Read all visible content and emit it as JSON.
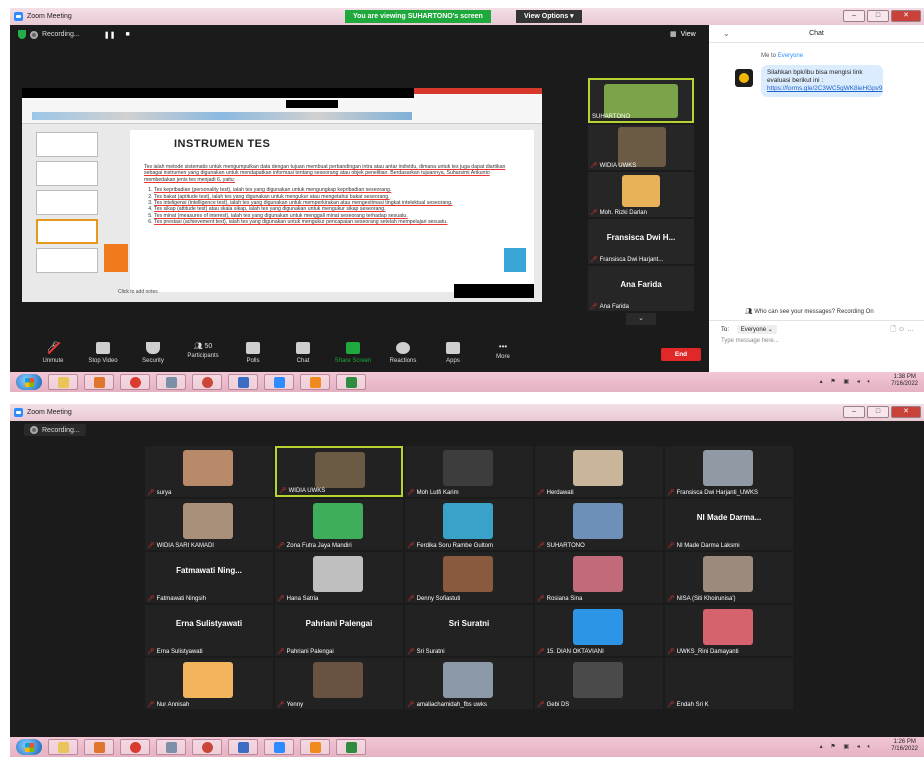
{
  "window1": {
    "title": "Zoom Meeting",
    "viewing_banner": "You are viewing SUHARTONO's screen",
    "view_options": "View Options",
    "recording": "Recording...",
    "view_label": "View",
    "slide": {
      "heading": "INSTRUMEN TES",
      "intro": "Tes ialah metode sistematis untuk mengumpulkan data dengan tujuan membuat perbandingan intra atau antar individu, dimana untuk tes juga dapat diartikan sebagai instrumen yang digunakan untuk mendapatkan informasi tentang seseorang atau objek penelitian. Berdasarkan tujuannya, Suharsimi Arikunto membedakan jenis tes menjadi 6, yaitu:",
      "items": [
        "Tes kepribadian (personality test), ialah tes yang digunakan untuk mengungkap kepribadian seseorang.",
        "Tes bakat (aptitude test), ialah tes yang digunakan untuk mengukur atau mengetahui bakat seseorang.",
        "Tes inteligensi (intelligence test), ialah tes yang digunakan untuk memperkirakan atau mengestimasi tingkat intelektual seseorang.",
        "Tes sikap (attitude test) atau skala sikap, ialah tes yang digunakan untuk mengukur sikap seseorang.",
        "Tes minat (measures of interest), ialah tes yang digunakan untuk menggali minat seseorang terhadap sesuatu.",
        "Tes prestasi (achievement test), ialah tes yang digunakan untuk mengukur pencapaian seseorang setelah mempelajari sesuatu."
      ],
      "notes": "Click to add notes"
    },
    "side_participants": [
      {
        "name": "SUHARTONO",
        "type": "video",
        "color": "#7aa34a",
        "active": true
      },
      {
        "name": "WIDIA UWKS",
        "type": "video",
        "color": "#6b5a44",
        "active": false
      },
      {
        "name": "Moh. Rizki Darlan",
        "type": "video",
        "color": "#e8b15a",
        "active": false
      },
      {
        "name": "Fransisca Dwi Harjant...",
        "big": "Fransisca Dwi H...",
        "type": "name",
        "active": false
      },
      {
        "name": "Ana Farida",
        "big": "Ana Farida",
        "type": "name",
        "active": false
      }
    ],
    "chat": {
      "title": "Chat",
      "from": "Me to",
      "to_who": "Everyone",
      "message": "Silahkan bpk/ibu bisa mengisi link evaluasi berikut ini :",
      "link": "https://forms.gle/2C3WC5gWK8ieHGpv9",
      "who_can_see": "Who can see your messages? Recording On",
      "to_label": "To:",
      "to_select": "Everyone",
      "placeholder": "Type message here..."
    },
    "toolbar": [
      {
        "label": "Unmute",
        "icon": "microphone-muted-icon"
      },
      {
        "label": "Stop Video",
        "icon": "video-camera-icon"
      },
      {
        "label": "Security",
        "icon": "shield-icon"
      },
      {
        "label": "Participants",
        "icon": "participants-icon",
        "count": "50"
      },
      {
        "label": "Polls",
        "icon": "polls-icon"
      },
      {
        "label": "Chat",
        "icon": "chat-icon"
      },
      {
        "label": "Share Screen",
        "icon": "share-screen-icon"
      },
      {
        "label": "Reactions",
        "icon": "reactions-icon"
      },
      {
        "label": "Apps",
        "icon": "apps-icon"
      },
      {
        "label": "More",
        "icon": "more-icon"
      }
    ],
    "end": "End",
    "clock_time": "1:38 PM",
    "clock_date": "7/16/2022"
  },
  "window2": {
    "title": "Zoom Meeting",
    "recording": "Recording...",
    "rows": [
      [
        {
          "name": "surya",
          "type": "video",
          "color": "#b88a6a"
        },
        {
          "name": "WIDIA UWKS",
          "type": "video",
          "color": "#6b5a44",
          "active": true
        },
        {
          "name": "Moh Lutfi Karim",
          "type": "video",
          "color": "#3d3d3d"
        },
        {
          "name": "Herdawati",
          "type": "video",
          "color": "#c9b59a"
        },
        {
          "name": "Fransisca Dwi Harjanti_UWKS",
          "type": "video",
          "color": "#8f9aa5"
        }
      ],
      [
        {
          "name": "WIDIA SARI KAMADI",
          "type": "video",
          "color": "#a8907a"
        },
        {
          "name": "Zona Futra Jaya Mandiri",
          "type": "video",
          "color": "#3fae5b"
        },
        {
          "name": "Ferdika Soru Rambe Gultom",
          "type": "video",
          "color": "#3aa1c9"
        },
        {
          "name": "SUHARTONO",
          "type": "video",
          "color": "#6e8fb8"
        },
        {
          "name": "NI Made Darma Laksmi",
          "big": "NI Made Darma...",
          "type": "name"
        }
      ],
      [
        {
          "name": "Fatmawati Ningsih",
          "big": "Fatmawati Ning...",
          "type": "name"
        },
        {
          "name": "Hana Satria",
          "type": "video",
          "color": "#bfbfbf"
        },
        {
          "name": "Denny Sofiastuti",
          "type": "video",
          "color": "#8a5a3e"
        },
        {
          "name": "Rosiana Sina",
          "type": "video",
          "color": "#c06a7a"
        },
        {
          "name": "NISA (Siti Khoirunisa')",
          "type": "video",
          "color": "#9c8b7c"
        }
      ],
      [
        {
          "name": "Erna Sulistyawati",
          "big": "Erna Sulistyawati",
          "type": "name"
        },
        {
          "name": "Pahriani Palengai",
          "big": "Pahriani Palengai",
          "type": "name"
        },
        {
          "name": "Sri Suratni",
          "big": "Sri Suratni",
          "type": "name"
        },
        {
          "name": "15. DIAN OKTAVIANI",
          "type": "video",
          "color": "#2d95e6"
        },
        {
          "name": "UWKS_Rini Damayanti",
          "type": "video",
          "color": "#d6626e"
        }
      ],
      [
        {
          "name": "Nur Annisah",
          "type": "video",
          "color": "#f3b45e"
        },
        {
          "name": "Yenny",
          "type": "video",
          "color": "#6a5243"
        },
        {
          "name": "amaliachamidah_fbs uwks",
          "type": "video",
          "color": "#8b98a8"
        },
        {
          "name": "Gebi DS",
          "type": "video",
          "color": "#4a4a4a"
        },
        {
          "name": "Endah Sri K",
          "type": "blank"
        }
      ]
    ],
    "clock_time": "1:26 PM",
    "clock_date": "7/16/2022"
  },
  "taskbar_icons": [
    {
      "name": "explorer-icon",
      "color": "#e8c45a"
    },
    {
      "name": "media-player-icon",
      "color": "#e0752d"
    },
    {
      "name": "chrome-icon",
      "color": "#d93b30"
    },
    {
      "name": "paint-icon",
      "color": "#7b8fa8"
    },
    {
      "name": "network-icon",
      "color": "#c9463a"
    },
    {
      "name": "notes-icon",
      "color": "#3d6cc4"
    },
    {
      "name": "zoom-icon",
      "color": "#2d8cff"
    },
    {
      "name": "app-orange-icon",
      "color": "#f08a1c"
    },
    {
      "name": "excel-icon",
      "color": "#2f8b3e"
    }
  ]
}
